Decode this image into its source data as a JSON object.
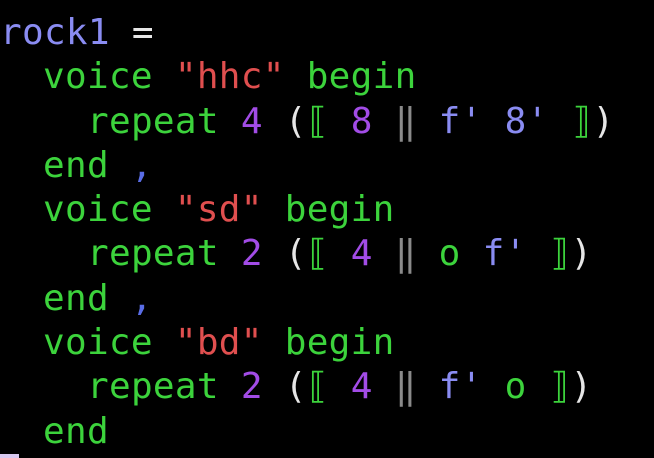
{
  "editor": {
    "lines": [
      {
        "tokens": [
          {
            "t": "rock1",
            "c": "id"
          },
          {
            "t": " = ",
            "c": "op"
          }
        ]
      },
      {
        "tokens": [
          {
            "t": "voice",
            "c": "kw"
          },
          {
            "t": " ",
            "c": "op"
          },
          {
            "t": "\"hhc\"",
            "c": "str"
          },
          {
            "t": " begin",
            "c": "kw"
          }
        ]
      },
      {
        "tokens": [
          {
            "t": "repeat",
            "c": "kw"
          },
          {
            "t": " ",
            "c": "op"
          },
          {
            "t": "4",
            "c": "num"
          },
          {
            "t": " (",
            "c": "punct"
          },
          {
            "t": "⟦",
            "c": "brk"
          },
          {
            "t": " ",
            "c": "op"
          },
          {
            "t": "8",
            "c": "num"
          },
          {
            "t": " ",
            "c": "op"
          },
          {
            "t": "‖",
            "c": "sep"
          },
          {
            "t": " f' 8' ",
            "c": "note"
          },
          {
            "t": "⟧",
            "c": "brk"
          },
          {
            "t": ")",
            "c": "punct"
          }
        ]
      },
      {
        "tokens": [
          {
            "t": "end",
            "c": "kw"
          },
          {
            "t": " ,",
            "c": "comma"
          }
        ]
      },
      {
        "tokens": [
          {
            "t": "voice",
            "c": "kw"
          },
          {
            "t": " ",
            "c": "op"
          },
          {
            "t": "\"sd\"",
            "c": "str"
          },
          {
            "t": " begin",
            "c": "kw"
          }
        ]
      },
      {
        "tokens": [
          {
            "t": "repeat",
            "c": "kw"
          },
          {
            "t": " ",
            "c": "op"
          },
          {
            "t": "2",
            "c": "num"
          },
          {
            "t": " (",
            "c": "punct"
          },
          {
            "t": "⟦",
            "c": "brk"
          },
          {
            "t": " ",
            "c": "op"
          },
          {
            "t": "4",
            "c": "num"
          },
          {
            "t": " ",
            "c": "op"
          },
          {
            "t": "‖",
            "c": "sep"
          },
          {
            "t": " o ",
            "c": "kw"
          },
          {
            "t": "f' ",
            "c": "note"
          },
          {
            "t": "⟧",
            "c": "brk"
          },
          {
            "t": ")",
            "c": "punct"
          }
        ]
      },
      {
        "tokens": [
          {
            "t": "end",
            "c": "kw"
          },
          {
            "t": " ,",
            "c": "comma"
          }
        ]
      },
      {
        "tokens": [
          {
            "t": "voice",
            "c": "kw"
          },
          {
            "t": " ",
            "c": "op"
          },
          {
            "t": "\"bd\"",
            "c": "str"
          },
          {
            "t": " begin",
            "c": "kw"
          }
        ]
      },
      {
        "tokens": [
          {
            "t": "repeat",
            "c": "kw"
          },
          {
            "t": " ",
            "c": "op"
          },
          {
            "t": "2",
            "c": "num"
          },
          {
            "t": " (",
            "c": "punct"
          },
          {
            "t": "⟦",
            "c": "brk"
          },
          {
            "t": " ",
            "c": "op"
          },
          {
            "t": "4",
            "c": "num"
          },
          {
            "t": " ",
            "c": "op"
          },
          {
            "t": "‖",
            "c": "sep"
          },
          {
            "t": " f' ",
            "c": "note"
          },
          {
            "t": "o ",
            "c": "kw"
          },
          {
            "t": "⟧",
            "c": "brk"
          },
          {
            "t": ")",
            "c": "punct"
          }
        ]
      },
      {
        "tokens": [
          {
            "t": "end",
            "c": "kw"
          }
        ]
      }
    ]
  },
  "colors": {
    "background": "#000000",
    "identifier": "#8a8cf2",
    "keyword": "#3cd33c",
    "string": "#e04f4f",
    "number": "#a24ce6",
    "cursor": "#d8c8f0"
  }
}
